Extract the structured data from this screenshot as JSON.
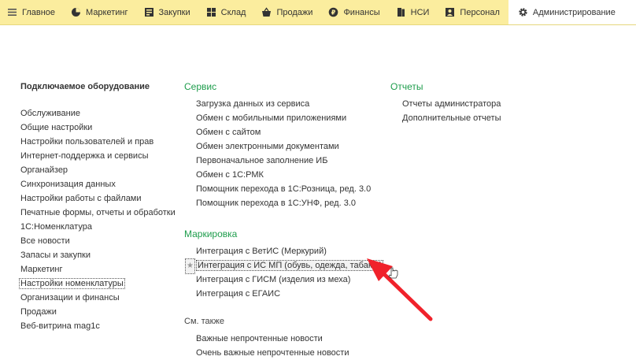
{
  "topbar": {
    "tabs": [
      {
        "label": "Главное",
        "icon": "hamburger-icon"
      },
      {
        "label": "Маркетинг",
        "icon": "pie-chart-icon"
      },
      {
        "label": "Закупки",
        "icon": "purchases-icon"
      },
      {
        "label": "Склад",
        "icon": "warehouse-icon"
      },
      {
        "label": "Продажи",
        "icon": "sales-basket-icon"
      },
      {
        "label": "Финансы",
        "icon": "ruble-coin-icon"
      },
      {
        "label": "НСИ",
        "icon": "reference-book-icon"
      },
      {
        "label": "Персонал",
        "icon": "person-icon"
      },
      {
        "label": "Администрирование",
        "icon": "gear-icon",
        "active": true
      }
    ]
  },
  "left_column": {
    "heading": "Подключаемое оборудование",
    "items": [
      "Обслуживание",
      "Общие настройки",
      "Настройки пользователей и прав",
      "Интернет-поддержка и сервисы",
      "Органайзер",
      "Синхронизация данных",
      "Настройки работы с файлами",
      "Печатные формы, отчеты и обработки",
      "1С:Номенклатура",
      "Все новости",
      "Запасы и закупки",
      "Маркетинг",
      "Настройки номенклатуры",
      "Организации и финансы",
      "Продажи",
      "Веб-витрина mag1c"
    ],
    "selected_index": 12
  },
  "service": {
    "heading": "Сервис",
    "items": [
      "Загрузка данных из сервиса",
      "Обмен с мобильными приложениями",
      "Обмен с сайтом",
      "Обмен электронными документами",
      "Первоначальное заполнение ИБ",
      "Обмен с 1С:РМК",
      "Помощник перехода в 1С:Розница, ред. 3.0",
      "Помощник перехода в 1С:УНФ, ред. 3.0"
    ]
  },
  "marking": {
    "heading": "Маркировка",
    "items": [
      "Интеграция с ВетИС (Меркурий)",
      "Интеграция с ИС МП (обувь, одежда, табак...)",
      "Интеграция с ГИСМ (изделия из меха)",
      "Интеграция с ЕГАИС"
    ],
    "highlighted_index": 1,
    "star_glyph": "★"
  },
  "see_also": {
    "heading": "См. также",
    "items": [
      "Важные непрочтенные новости",
      "Очень важные непрочтенные новости"
    ]
  },
  "reports": {
    "heading": "Отчеты",
    "items": [
      "Отчеты администратора",
      "Дополнительные отчеты"
    ]
  },
  "colors": {
    "topbar_bg": "#fbed9e",
    "section_heading": "#1e9d4c",
    "annotation_arrow": "#f0222b"
  }
}
